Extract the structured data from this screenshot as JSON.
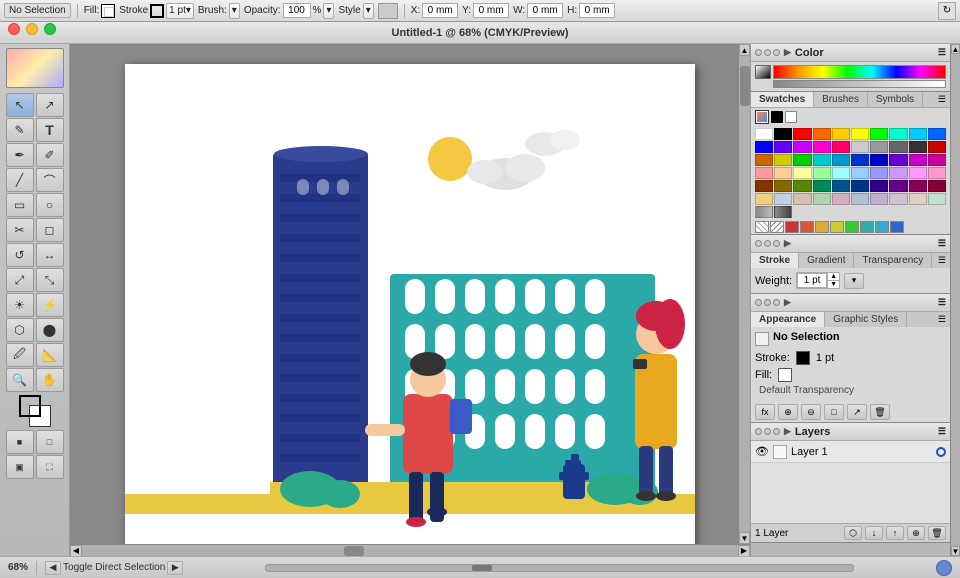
{
  "topbar": {
    "selection_label": "No Selection",
    "fill_label": "Fill:",
    "stroke_label": "Stroke",
    "stroke_value": "1 pt",
    "brush_label": "Brush:",
    "opacity_label": "Opacity:",
    "opacity_value": "100",
    "style_label": "Style",
    "x_label": "X:",
    "x_value": "0 mm",
    "y_label": "Y:",
    "y_value": "0 mm",
    "w_label": "W:",
    "w_value": "0 mm",
    "h_label": "H:",
    "h_value": "0 mm"
  },
  "titlebar": {
    "title": "Untitled-1 @ 68% (CMYK/Preview)"
  },
  "tools": [
    "↖",
    "↗",
    "✎",
    "⌨",
    "✒",
    "✐",
    "⬡",
    "⬟",
    "⬜",
    "○",
    "✂",
    "⬘",
    "⬰",
    "⬱",
    "◎",
    "◉",
    "☀",
    "⚡",
    "⬡",
    "⬤",
    "🔍",
    "✋",
    "■",
    "▦"
  ],
  "color_panel": {
    "title": "Color",
    "gradient_label": "gradient bar"
  },
  "swatches_panel": {
    "tabs": [
      "Swatches",
      "Brushes",
      "Symbols"
    ],
    "active_tab": "Swatches",
    "colors": [
      "#ffffff",
      "#000000",
      "#ff0000",
      "#ff6600",
      "#ffcc00",
      "#ffff00",
      "#00ff00",
      "#00ffcc",
      "#00ccff",
      "#0066ff",
      "#0000ff",
      "#6600ff",
      "#cc00ff",
      "#ff00cc",
      "#ff0066",
      "#cccccc",
      "#999999",
      "#666666",
      "#333333",
      "#cc0000",
      "#cc6600",
      "#cccc00",
      "#00cc00",
      "#00cccc",
      "#0099cc",
      "#0033cc",
      "#0000cc",
      "#6600cc",
      "#cc00cc",
      "#cc0099",
      "#ff9999",
      "#ffcc99",
      "#ffff99",
      "#99ff99",
      "#99ffff",
      "#99ccff",
      "#9999ff",
      "#cc99ff",
      "#ff99ff",
      "#ff99cc",
      "#883300",
      "#886600",
      "#558800",
      "#008855",
      "#005588",
      "#003388",
      "#330088",
      "#660088",
      "#880055",
      "#880033",
      "#f0d080",
      "#c0d0e0",
      "#d0c0b0",
      "#b0d0b0",
      "#d0b0c0",
      "#b0c0d0",
      "#c0b0d0",
      "#d0c0d0",
      "#e0d0c0",
      "#c0e0d0"
    ]
  },
  "stroke_panel": {
    "tabs": [
      "Stroke",
      "Gradient",
      "Transparency"
    ],
    "active_tab": "Stroke",
    "weight_label": "Weight:",
    "weight_value": "1 pt"
  },
  "appearance_panel": {
    "tabs": [
      "Appearance",
      "Graphic Styles"
    ],
    "active_tab": "Appearance",
    "title": "No Selection",
    "stroke_label": "Stroke:",
    "stroke_color": "#000000",
    "stroke_value": "1 pt",
    "fill_label": "Fill:",
    "fill_color": "#ffffff",
    "transparency_label": "Default Transparency",
    "buttons": [
      "fx",
      "⊕",
      "⊖",
      "□",
      "↗",
      "🗑"
    ]
  },
  "layers_panel": {
    "title": "Layers",
    "layers": [
      {
        "name": "Layer 1",
        "visible": true,
        "color": "#2255bb"
      }
    ],
    "count_label": "1 Layer",
    "footer_buttons": [
      "⬡",
      "↓",
      "↑",
      "⊖",
      "🗑"
    ]
  },
  "statusbar": {
    "zoom": "68%",
    "nav_button": "Toggle Direct Selection",
    "arrow": "▶"
  }
}
